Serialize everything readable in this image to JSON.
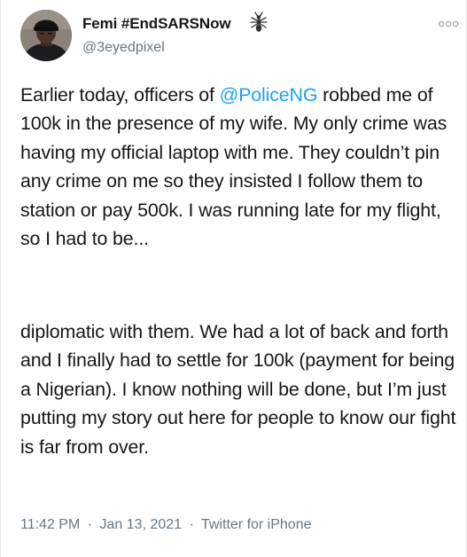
{
  "author": {
    "name": "Femi #EndSARSNow",
    "handle": "@3eyedpixel",
    "avatar": "profile-photo",
    "badge_icon": "ant-icon"
  },
  "menu": {
    "icon": "more-icon"
  },
  "tweet": {
    "paragraph1": {
      "before_mention": "Earlier today, officers of ",
      "mention": "@PoliceNG",
      "after_mention": " robbed me of 100k in the presence of my wife. My only crime was having my official laptop with me. They couldn’t pin any crime on me so they insisted I follow them to station or pay 500k. I was running late for my flight, so I had to be..."
    },
    "paragraph2": "diplomatic with them. We had a lot of back and forth and I finally had to settle for 100k (payment for being a Nigerian). I know nothing will be done, but I’m just putting my story out here for people to know our fight is far from over."
  },
  "meta": {
    "time": "11:42 PM",
    "separator": "·",
    "date": "Jan 13, 2021",
    "source": "Twitter for iPhone"
  },
  "colors": {
    "link": "#1da1f2",
    "secondary_text": "#657786",
    "primary_text": "#14171a"
  }
}
